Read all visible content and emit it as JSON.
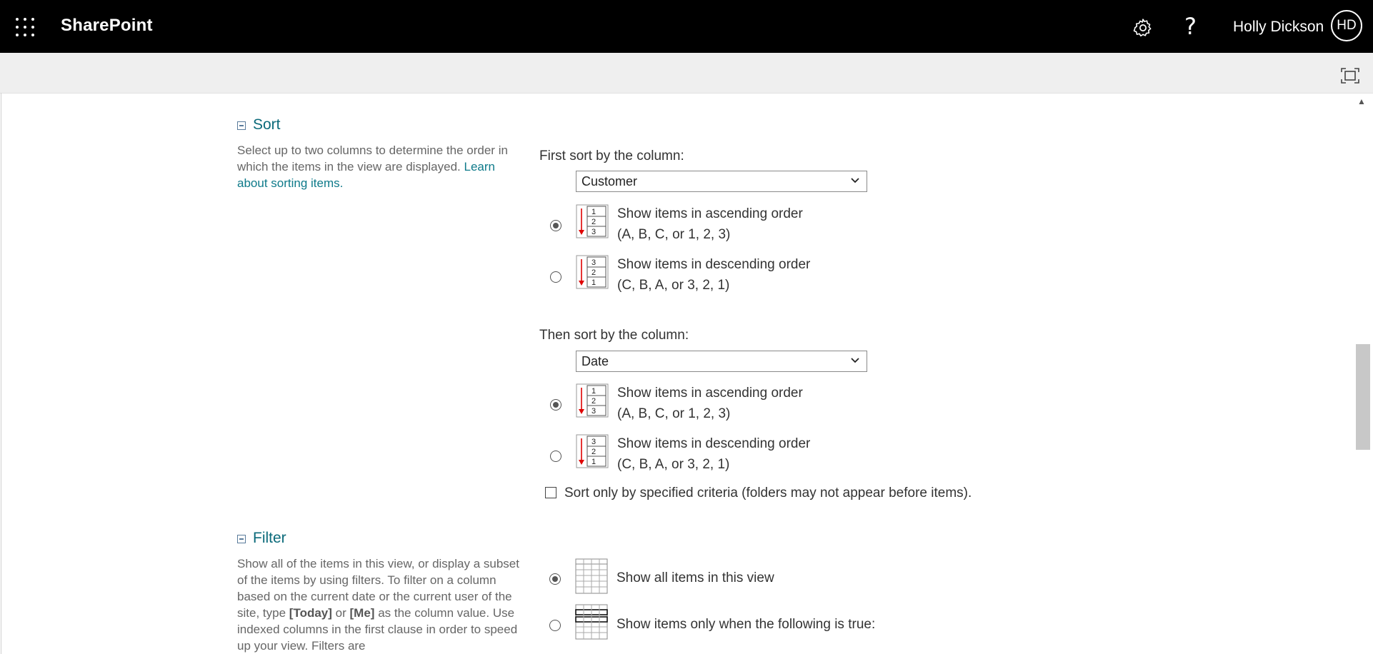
{
  "suitebar": {
    "app_name": "SharePoint",
    "user_name": "Holly Dickson",
    "avatar_initials": "HD",
    "help_glyph": "?"
  },
  "sort": {
    "title": "Sort",
    "description": "Select up to two columns to determine the order in which the items in the view are displayed.",
    "learn_link": "Learn about sorting items.",
    "first": {
      "label": "First sort by the column:",
      "selected": "Customer",
      "ascending": {
        "line1": "Show items in ascending order",
        "line2": "(A, B, C, or 1, 2, 3)",
        "checked": true
      },
      "descending": {
        "line1": "Show items in descending order",
        "line2": "(C, B, A, or 3, 2, 1)",
        "checked": false
      }
    },
    "second": {
      "label": "Then sort by the column:",
      "selected": "Date",
      "ascending": {
        "line1": "Show items in ascending order",
        "line2": "(A, B, C, or 1, 2, 3)",
        "checked": true
      },
      "descending": {
        "line1": "Show items in descending order",
        "line2": "(C, B, A, or 3, 2, 1)",
        "checked": false
      }
    },
    "only_specified": "Sort only by specified criteria (folders may not appear before items)."
  },
  "filter": {
    "title": "Filter",
    "desc_part1": "Show all of the items in this view, or display a subset of the items by using filters. To filter on a column based on the current date or the current user of the site, type",
    "today_token": "[Today]",
    "or_word": "or",
    "me_token": "[Me]",
    "desc_part2": "as the column value. Use indexed columns in the first clause in order to speed up your view. Filters are",
    "show_all": "Show all items in this view",
    "show_when": "Show items only when the following is true:"
  },
  "colors": {
    "link": "#0e7a8a",
    "suitebar": "#000000",
    "arrow": "#e00000"
  }
}
